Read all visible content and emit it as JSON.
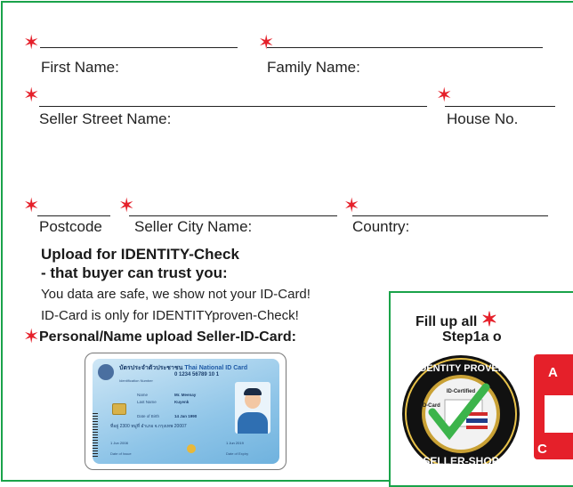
{
  "form": {
    "first_name_label": "First Name:",
    "family_name_label": "Family Name:",
    "seller_street_label": "Seller Street Name:",
    "house_no_label": "House No.",
    "postcode_label": "Postcode",
    "seller_city_label": "Seller City Name:",
    "country_label": "Country:",
    "required_marker": "✶"
  },
  "upload": {
    "heading_line1": "Upload for IDENTITY-Check",
    "heading_line2": "- that buyer can trust you:",
    "note_line1": "You data are safe, we show not your ID-Card!",
    "note_line2": "ID-Card is only for IDENTITYproven-Check!",
    "personal_upload_label": "Personal/Name upload  Seller-ID-Card:"
  },
  "id_card": {
    "title_thai": "บัตรประจำตัวประชาชน",
    "title_en": "Thai National ID Card",
    "id_number": "0 1234 56789 10 1",
    "id_number_label": "Identification Number",
    "name_label": "Name",
    "name_value": "Mr. Meenay",
    "last_name_label": "Last Name",
    "last_name_value": "Kuyenk",
    "dob_label": "Date of Birth",
    "dob_value": "14 Jan 1990",
    "address": "ที่อยู่ 2300 หมู่ที่ อำเภอ จ.กรุงเทพ 20007",
    "issue_date": "1 Jun 2008",
    "issue_label": "Date of Issue",
    "expiry_date": "1 Jun 2019",
    "expiry_label": "Date of Expiry"
  },
  "promo": {
    "line1": "Fill up all",
    "line2": "Step1a o",
    "badge_top": "IDENTITY PROVEN",
    "badge_bottom": "SELLER-SHOP",
    "badge_tag1": "ID-Certified",
    "badge_tag2": "ID-Card",
    "red_letter_top": "A",
    "red_letter_bottom": "C"
  },
  "colors": {
    "accent_green": "#1aa34a",
    "required_red": "#e5202a"
  }
}
